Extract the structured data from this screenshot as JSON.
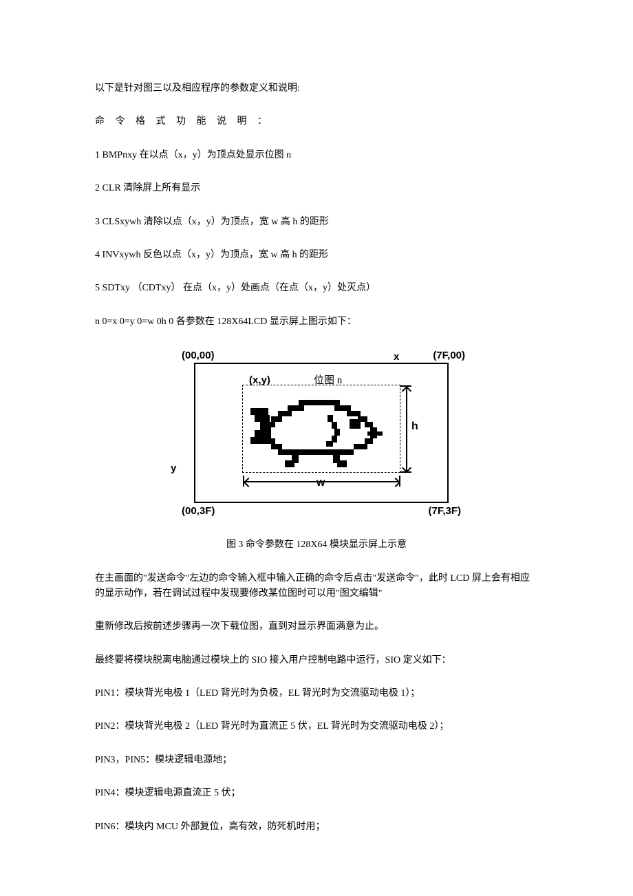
{
  "intro": "以下是针对图三以及相应程序的参数定义和说明:",
  "heading": "命 令 格 式 功 能 说 明 ：",
  "commands": [
    "1 BMPnxy 在以点（x，y）为顶点处显示位图 n",
    "2 CLR 清除屏上所有显示",
    "3 CLSxywh 清除以点（x，y）为顶点，宽 w 高 h 的距形",
    "4 INVxywh 反色以点（x，y）为顶点，宽 w 高 h 的距形",
    "5 SDTxy （CDTxy） 在点（x，y）处画点（在点（x，y）处灭点）"
  ],
  "params_note": "n 0=x 0=y 0=w 0h 0 各参数在 128X64LCD 显示屏上图示如下：",
  "figure": {
    "tl": "(00,00)",
    "tr": "(7F,00)",
    "bl": "(00,3F)",
    "br": "(7F,3F)",
    "xlabel": "x",
    "ylabel": "y",
    "xy": "(x,y)",
    "bmp": "位图 n",
    "w": "w",
    "h": "h"
  },
  "caption": "图 3 命令参数在 128X64 模块显示屏上示意",
  "paras": [
    "在主画面的\"发送命令\"左边的命令输入框中输入正确的命令后点击\"发送命令\"，此时 LCD 屏上会有相应的显示动作，若在调试过程中发现要修改某位图时可以用\"图文编辑\"",
    "重新修改后按前述步骤再一次下载位图，直到对显示界面满意为止。",
    "最终要将模块脱离电脑通过模块上的 SIO 接入用户控制电路中运行，SIO 定义如下：",
    "PIN1：模块背光电极 1（LED 背光时为负极，EL 背光时为交流驱动电极 1）；",
    "PIN2：模块背光电极 2（LED 背光时为直流正 5 伏，EL 背光时为交流驱动电极 2）；",
    "PIN3，PIN5：模块逻辑电源地；",
    "PIN4：模块逻辑电源直流正 5 伏；",
    "PIN6：模块内 MCU 外部复位，高有效，防死机时用；"
  ]
}
